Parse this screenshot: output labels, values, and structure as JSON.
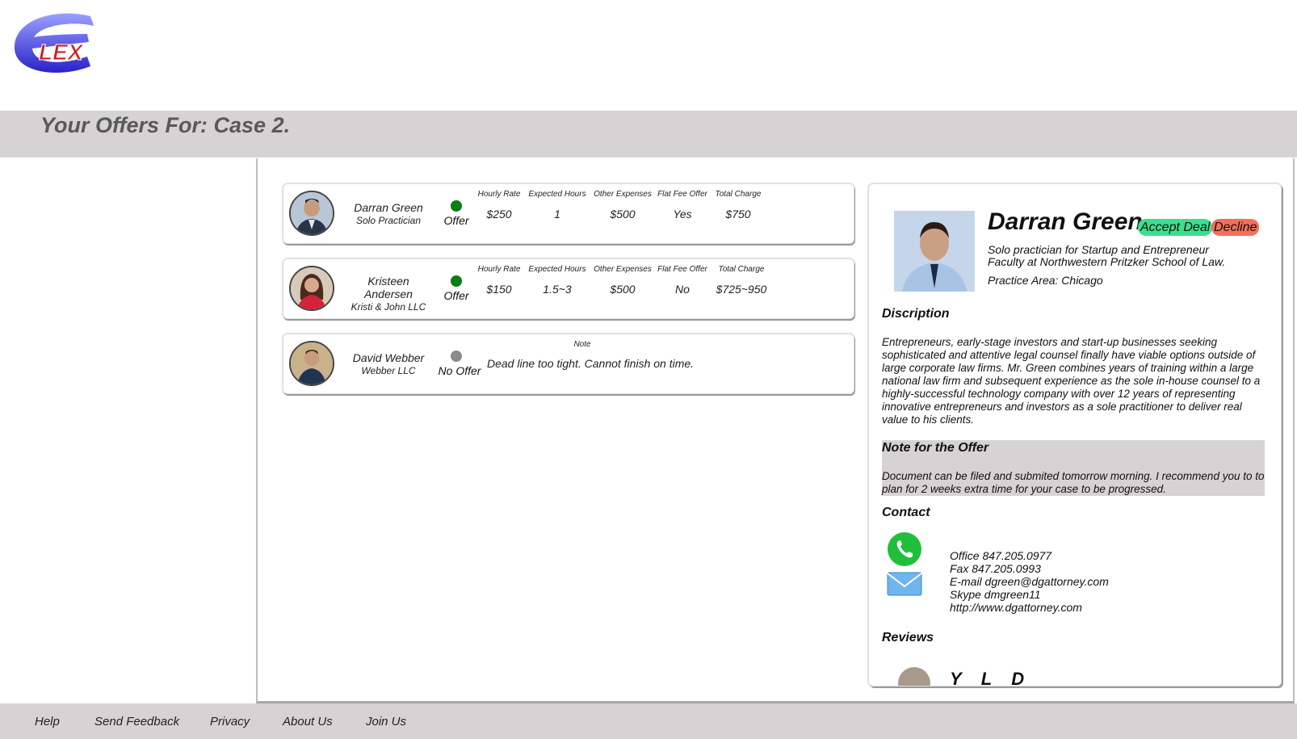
{
  "header": {
    "logo_text": "LEX",
    "title": "Your Offers For: Case 2."
  },
  "offers": [
    {
      "name": "Darran Green",
      "firm": "Solo Practician",
      "status": "Offer",
      "status_color": "#0a7d14",
      "headers": [
        "Hourly Rate",
        "Expected Hours",
        "Other Expenses",
        "Flat Fee Offer",
        "Total Charge"
      ],
      "values": [
        "$250",
        "1",
        "$500",
        "Yes",
        "$750"
      ]
    },
    {
      "name_line1": "Kristeen",
      "name_line2": "Andersen",
      "firm": "Kristi & John LLC",
      "status": "Offer",
      "status_color": "#0a7d14",
      "headers": [
        "Hourly Rate",
        "Expected Hours",
        "Other Expenses",
        "Flat Fee Offer",
        "Total Charge"
      ],
      "values": [
        "$150",
        "1.5~3",
        "$500",
        "No",
        "$725~950"
      ]
    },
    {
      "name": "David Webber",
      "firm": "Webber LLC",
      "status": "No Offer",
      "status_color": "#8c8c8c",
      "note_header": "Note",
      "note": "Dead line too tight. Cannot finish on time."
    }
  ],
  "detail": {
    "name": "Darran Green",
    "accept_label": "Accept Deal",
    "decline_label": "Decline",
    "accept_color": "#3ddf8c",
    "decline_color": "#f46f5a",
    "tagline1": "Solo practician for Startup and Entrepreneur",
    "tagline2": "Faculty at Northwestern Pritzker School of Law.",
    "practice_area": "Practice Area: Chicago",
    "description_heading": "Discription",
    "description": "Entrepreneurs, early-stage investors and start-up businesses seeking sophisticated and attentive legal counsel finally have viable options outside of large corporate law firms.  Mr. Green combines years of training within a large national law firm and subsequent experience as the sole in-house counsel to a highly-successful technology company with over 12 years of representing innovative entrepreneurs and investors as a sole practitioner to deliver real value to his clients.",
    "note_heading": "Note for the Offer",
    "note": "Document can be filed and submited tomorrow morning. I recommend you to to plan for 2 weeks extra time for your case to be progressed.",
    "contact_heading": "Contact",
    "contact_lines": [
      "Office 847.205.0977",
      "Fax 847.205.0993",
      "E-mail dgreen@dgattorney.com",
      "Skype dmgreen11",
      "http://www.dgattorney.com"
    ],
    "reviews_heading": "Reviews",
    "review_partial": "Y    L    D"
  },
  "footer": {
    "links": [
      "Help",
      "Send Feedback",
      "Privacy",
      "About Us",
      "Join Us"
    ]
  }
}
